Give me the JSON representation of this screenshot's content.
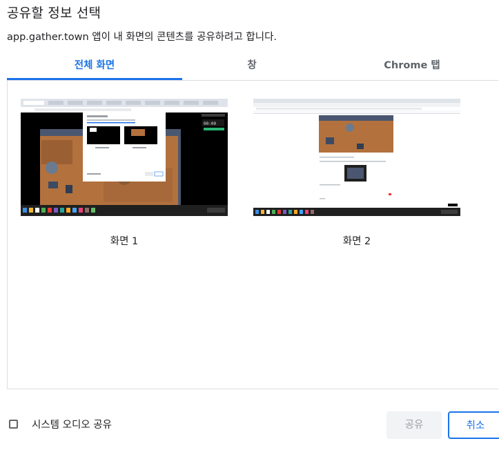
{
  "dialog": {
    "title": "공유할 정보 선택",
    "subtitle": "app.gather.town 앱이 내 화면의 콘텐츠를 공유하려고 합니다."
  },
  "tabs": [
    {
      "label": "전체 화면",
      "active": true
    },
    {
      "label": "창",
      "active": false
    },
    {
      "label": "Chrome 탭",
      "active": false
    }
  ],
  "sources": [
    {
      "label": "화면 1"
    },
    {
      "label": "화면 2"
    }
  ],
  "footer": {
    "system_audio_label": "시스템 오디오 공유",
    "system_audio_checked": false,
    "share_label": "공유",
    "cancel_label": "취소"
  },
  "colors": {
    "accent": "#1a73e8",
    "text": "#202124",
    "muted": "#5f6368",
    "disabled_bg": "#f1f3f4",
    "border": "#dadce0"
  }
}
